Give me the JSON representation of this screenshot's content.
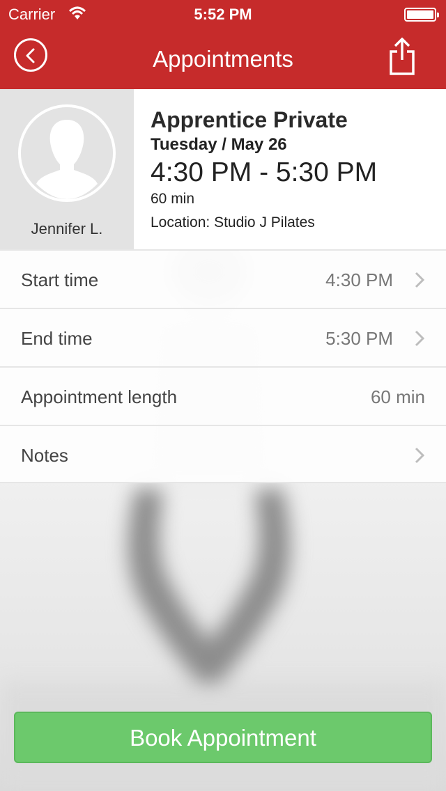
{
  "status_bar": {
    "carrier": "Carrier",
    "time": "5:52 PM"
  },
  "header": {
    "title": "Appointments",
    "back_icon": "chevron-left-circle-icon",
    "share_icon": "share-icon",
    "color": "#c62b2b"
  },
  "profile": {
    "name": "Jennifer L.",
    "avatar_icon": "person-silhouette-icon"
  },
  "appointment": {
    "class_name": "Apprentice Private",
    "date": "Tuesday / May 26",
    "time_range": "4:30 PM - 5:30 PM",
    "duration": "60 min",
    "location": "Location: Studio J Pilates"
  },
  "rows": [
    {
      "label": "Start time",
      "value": "4:30 PM",
      "has_arrow": true
    },
    {
      "label": "End time",
      "value": "5:30 PM",
      "has_arrow": true
    },
    {
      "label": "Appointment length",
      "value": "60 min",
      "has_arrow": false
    },
    {
      "label": "Notes",
      "value": "",
      "has_arrow": true
    }
  ],
  "book_button": {
    "label": "Book Appointment",
    "color": "#6cc96c"
  }
}
